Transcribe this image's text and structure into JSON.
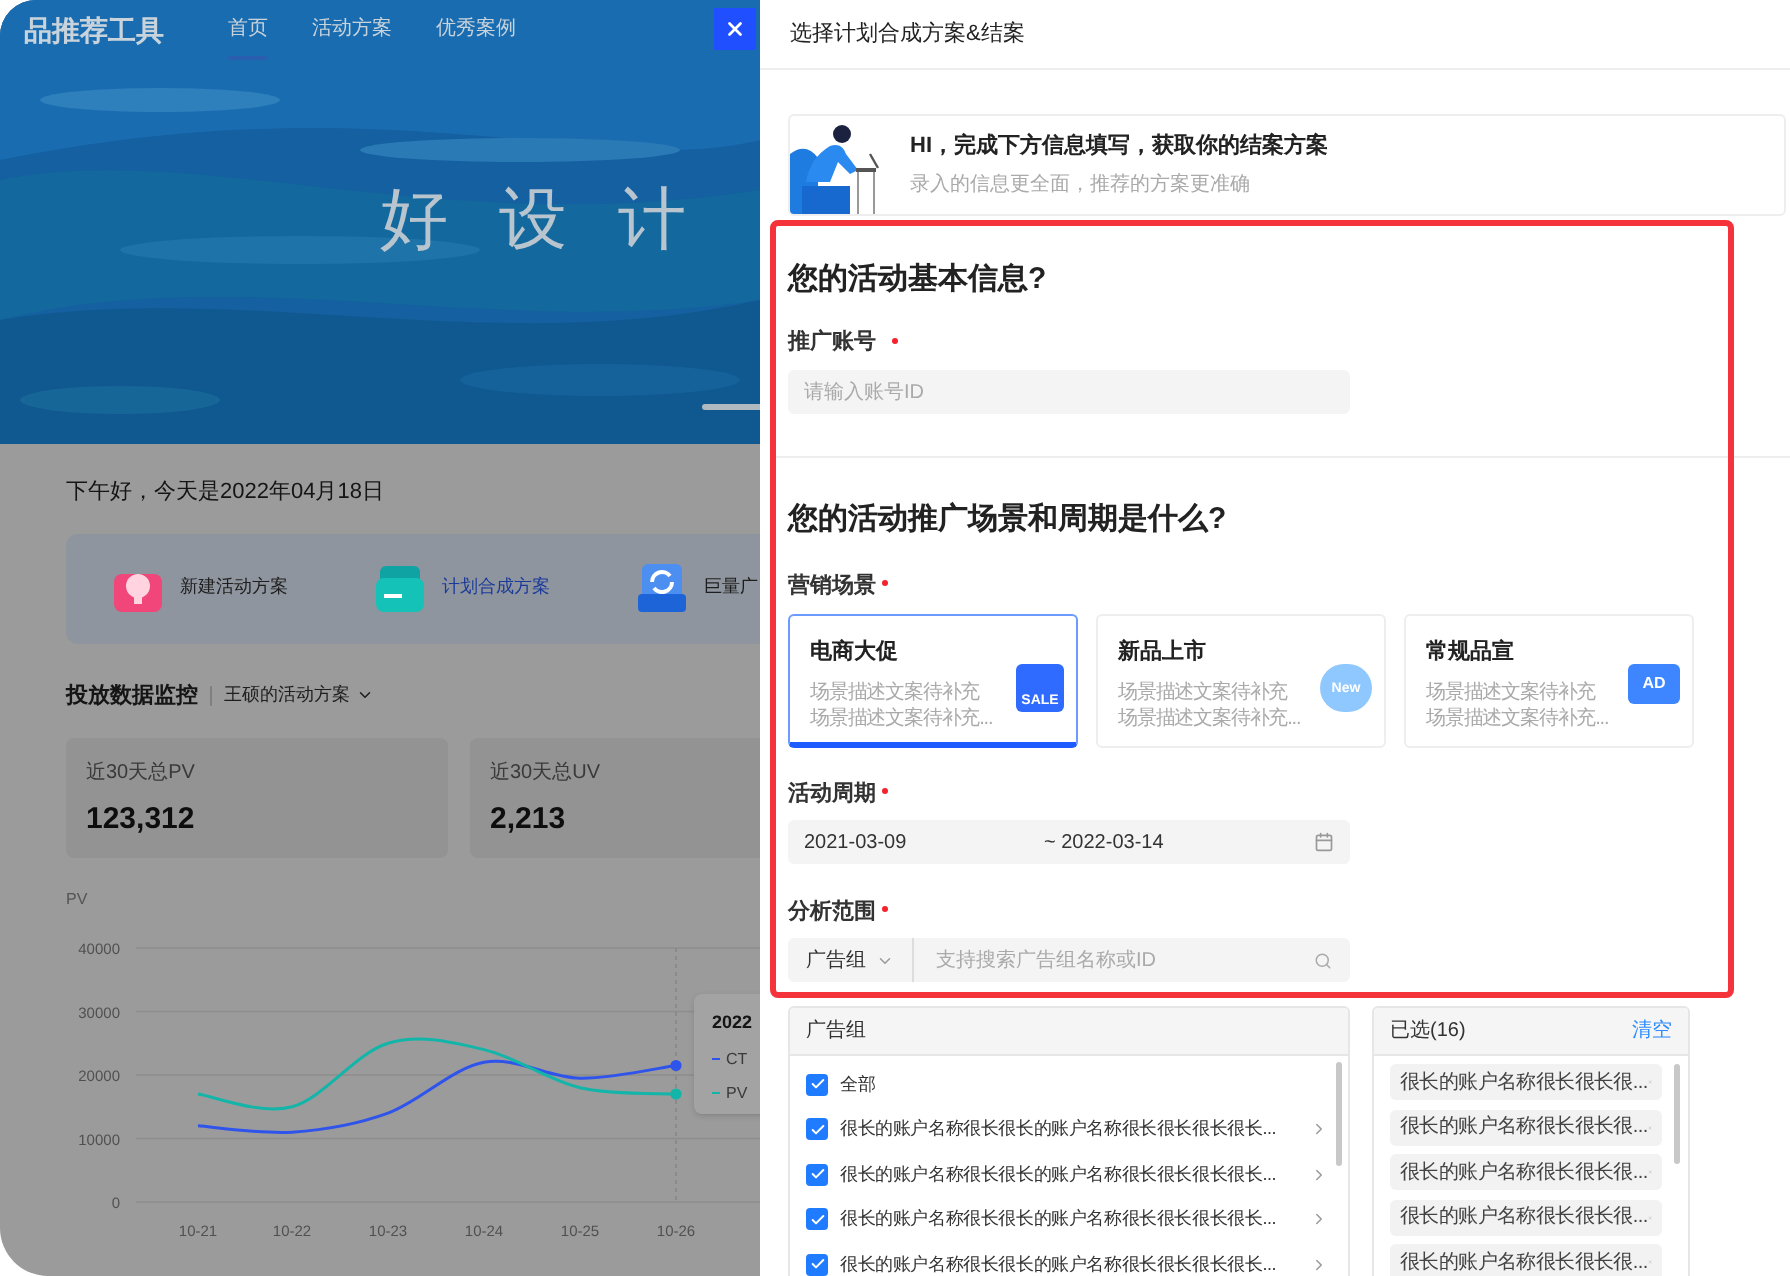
{
  "page": {
    "brand": "品推荐工具",
    "nav": [
      {
        "label": "首页",
        "selected": true
      },
      {
        "label": "活动方案",
        "selected": false
      },
      {
        "label": "优秀案例",
        "selected": false
      }
    ],
    "hero_title": "好 设 计",
    "greeting": "下午好，今天是2022年04月18日",
    "quick_actions": [
      {
        "label": "新建活动方案",
        "selected": false
      },
      {
        "label": "计划合成方案",
        "selected": true
      },
      {
        "label": "巨量广",
        "selected": false
      }
    ],
    "monitor": {
      "title": "投放数据监控",
      "plan_selector": "王硕的活动方案"
    },
    "stats": [
      {
        "label": "近30天总PV",
        "value": "123,312"
      },
      {
        "label": "近30天总UV",
        "value": "2,213"
      }
    ],
    "chart": {
      "tooltip_title": "2022",
      "chart_data": {
        "type": "line",
        "grid": true,
        "ref_lines": [
          {
            "axis": "x",
            "value": "10-26"
          }
        ],
        "legend": "right",
        "ylabel": "PV",
        "categories": [
          "10-21",
          "10-22",
          "10-23",
          "10-24",
          "10-25",
          "10-26"
        ],
        "yticks": [
          0,
          10000,
          20000,
          30000,
          40000
        ],
        "ylim": [
          0,
          40000
        ],
        "series": [
          {
            "name": "CT",
            "color": "#2f54eb",
            "values": [
              12000,
              11000,
              14000,
              22000,
              19500,
              21500
            ]
          },
          {
            "name": "PV",
            "color": "#13b5a8",
            "values": [
              17000,
              15000,
              25000,
              24000,
              18000,
              17000
            ]
          }
        ]
      }
    }
  },
  "drawer": {
    "title": "选择计划合成方案&结案",
    "banner": {
      "title": "HI，完成下方信息填写，获取你的结案方案",
      "subtitle": "录入的信息更全面，推荐的方案更准确"
    },
    "basic": {
      "heading": "您的活动基本信息?",
      "account_label": "推广账号",
      "account_required": true,
      "account_placeholder": "请输入账号ID"
    },
    "scene": {
      "heading": "您的活动推广场景和周期是什么?",
      "scene_label": "营销场景",
      "scene_required": true,
      "scenes": [
        {
          "title": "电商大促",
          "desc": [
            "场景描述文案待补充",
            "场景描述文案待补充..."
          ],
          "badge": "SALE",
          "selected": true
        },
        {
          "title": "新品上市",
          "desc": [
            "场景描述文案待补充",
            "场景描述文案待补充..."
          ],
          "badge": "New",
          "selected": false
        },
        {
          "title": "常规品宣",
          "desc": [
            "场景描述文案待补充",
            "场景描述文案待补充..."
          ],
          "badge": "AD",
          "selected": false
        }
      ],
      "period_label": "活动周期",
      "period_required": true,
      "start": "2021-03-09",
      "end": "~ 2022-03-14",
      "range_label": "分析范围",
      "range_required": true,
      "range_type": "广告组",
      "range_placeholder": "支持搜索广告组名称或ID"
    },
    "source": {
      "title": "广告组",
      "items": [
        {
          "label": "全部",
          "checked": true,
          "expandable": false
        },
        {
          "label": "很长的账户名称很长很长的账户名称很长很长很长很长...",
          "checked": true,
          "expandable": true
        },
        {
          "label": "很长的账户名称很长很长的账户名称很长很长很长很长...",
          "checked": true,
          "expandable": true
        },
        {
          "label": "很长的账户名称很长很长的账户名称很长很长很长很长...",
          "checked": true,
          "expandable": true
        },
        {
          "label": "很长的账户名称很长很长的账户名称很长很长很长很长...",
          "checked": true,
          "expandable": true
        }
      ]
    },
    "target": {
      "title": "已选(16)",
      "clear": "清空",
      "tags": [
        "很长的账户名称很长很长很...",
        "很长的账户名称很长很长很...",
        "很长的账户名称很长很长很...",
        "很长的账户名称很长很长很...",
        "很长的账户名称很长很长很..."
      ]
    }
  }
}
